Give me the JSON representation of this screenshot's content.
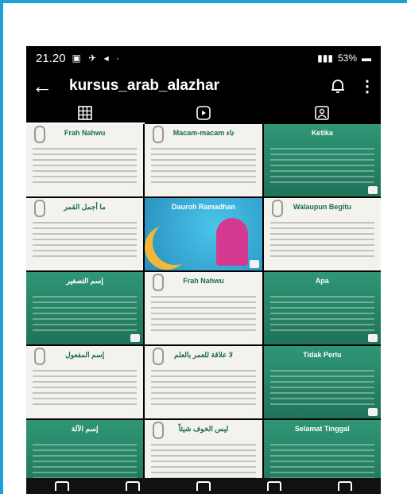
{
  "status_bar": {
    "time": "21.20",
    "battery": "53%"
  },
  "header": {
    "username": "kursus_arab_alazhar"
  },
  "posts": [
    {
      "style": "paper",
      "title": "Frah Nahwu"
    },
    {
      "style": "paper",
      "title": "Macam-macam تاء"
    },
    {
      "style": "green",
      "title": "Ketika"
    },
    {
      "style": "paper",
      "title": "ما أجمل القمر"
    },
    {
      "style": "photo",
      "title": "Dauroh Ramadhan"
    },
    {
      "style": "paper",
      "title": "Walaupun Begitu"
    },
    {
      "style": "green",
      "title": "إسم التصغير"
    },
    {
      "style": "paper",
      "title": "Frah Nahwu"
    },
    {
      "style": "green",
      "title": "Apa"
    },
    {
      "style": "paper",
      "title": "إسم المفعول"
    },
    {
      "style": "paper",
      "title": "لا علاقة للعمر بالعلم"
    },
    {
      "style": "green",
      "title": "Tidak Perlu"
    },
    {
      "style": "green",
      "title": "إسم الآلة"
    },
    {
      "style": "paper",
      "title": "ليس الخوف شيئاً"
    },
    {
      "style": "green",
      "title": "Selamat Tinggal"
    }
  ]
}
